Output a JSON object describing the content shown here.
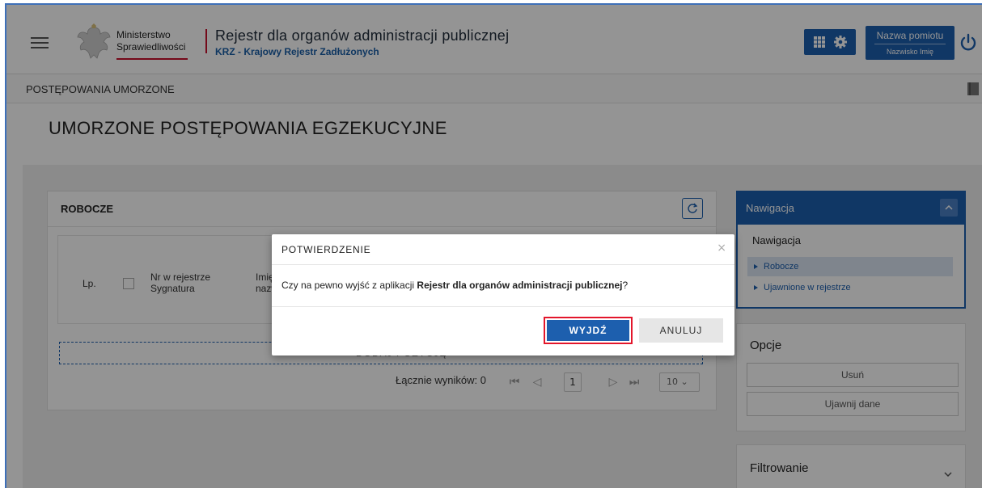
{
  "header": {
    "menu_icon": "hamburger-icon",
    "ministry_line1": "Ministerstwo",
    "ministry_line2": "Sprawiedliwości",
    "app_title": "Rejestr dla organów administracji publicznej",
    "app_subtitle": "KRZ - Krajowy Rejestr Zadłużonych",
    "apps_icon": "grid-icon",
    "settings_icon": "gear-icon",
    "user_name": "Nazwa pomiotu",
    "user_sub": "Nazwisko Imię",
    "logout_icon": "power-icon"
  },
  "breadcrumb": {
    "label": "POSTĘPOWANIA UMORZONE",
    "icon": "book-icon"
  },
  "page_title": "UMORZONE POSTĘPOWANIA EGZEKUCYJNE",
  "robocze": {
    "title": "ROBOCZE",
    "refresh_icon": "refresh-icon",
    "columns": {
      "lp": "Lp.",
      "nr_line1": "Nr w rejestrze",
      "nr_line2": "Sygnatura",
      "imie_line1": "Imię",
      "imie_line2": "nazw"
    },
    "add_label": "DODAJ POZYCJĘ",
    "total_label": "Łącznie wyników: 0",
    "page_number": "1",
    "page_size": "10"
  },
  "navigation": {
    "header": "Nawigacja",
    "title": "Nawigacja",
    "items": [
      {
        "label": "Robocze",
        "active": true
      },
      {
        "label": "Ujawnione w rejestrze",
        "active": false
      }
    ]
  },
  "options": {
    "title": "Opcje",
    "buttons": [
      "Usuń",
      "Ujawnij dane"
    ]
  },
  "filter": {
    "title": "Filtrowanie"
  },
  "dialog": {
    "title": "POTWIERDZENIE",
    "close": "×",
    "message_prefix": "Czy na pewno wyjść z aplikacji ",
    "message_bold": "Rejestr dla organów administracji publicznej",
    "message_suffix": "?",
    "confirm_label": "WYJDŹ",
    "cancel_label": "ANULUJ"
  },
  "colors": {
    "primary": "#1d5fae",
    "accent_red": "#e3162b"
  }
}
